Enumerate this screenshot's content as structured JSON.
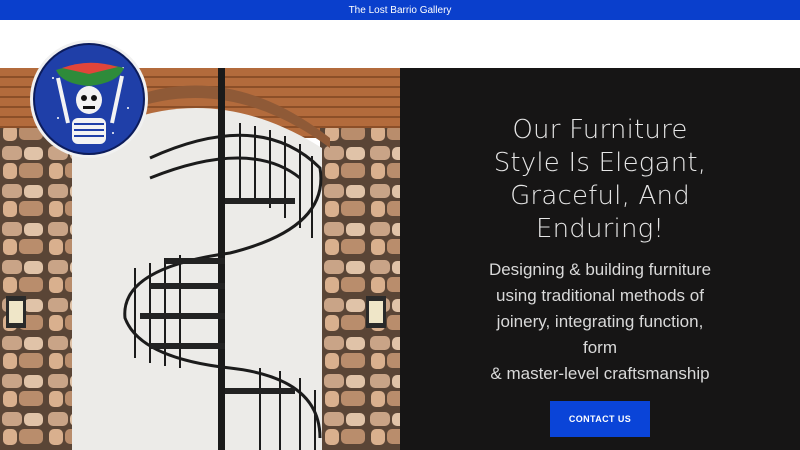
{
  "announcement": {
    "text": "The Lost Barrio Gallery"
  },
  "hero": {
    "title_lines": [
      "Our Furniture",
      "Style Is Elegant,",
      "Graceful, And",
      "Enduring!"
    ],
    "subtitle_lines": [
      "Designing & building furniture",
      "using traditional methods of",
      "joinery, integrating function,",
      "form",
      "& master-level craftsmanship"
    ],
    "cta_label": "CONTACT US"
  },
  "colors": {
    "accent": "#0a44d8",
    "announce_bg": "#0a3fcc",
    "panel_bg": "#161515"
  },
  "logo": {
    "icon": "skeleton-holding-watermelon-bowl-logo"
  }
}
